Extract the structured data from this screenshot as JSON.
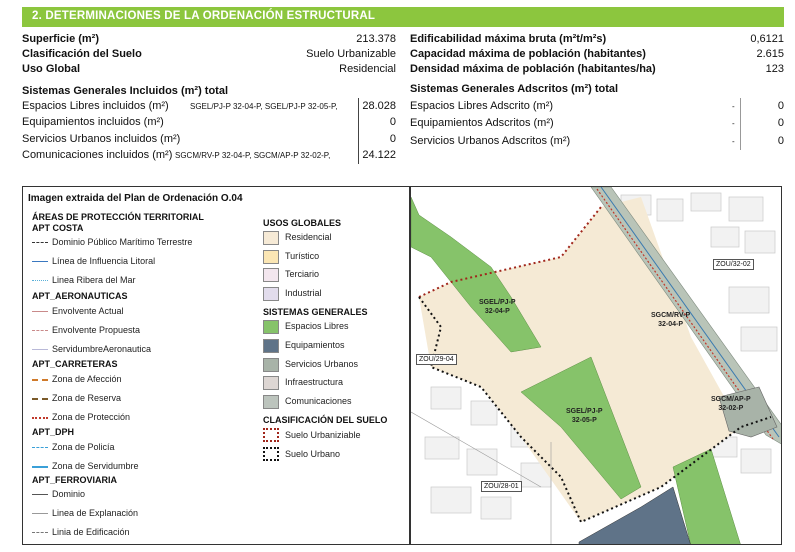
{
  "header": {
    "title": "2. DETERMINACIONES DE LA ORDENACIÓN ESTRUCTURAL"
  },
  "summary_left": [
    {
      "label": "Superficie (m²)",
      "value": "213.378"
    },
    {
      "label": "Clasificación del Suelo",
      "value": "Suelo Urbanizable"
    },
    {
      "label": "Uso Global",
      "value": "Residencial"
    }
  ],
  "summary_right": [
    {
      "label": "Edificabilidad máxima bruta  (m²t/m²s)",
      "value": "0,6121"
    },
    {
      "label": "Capacidad máxima de población (habitantes)",
      "value": "2.615"
    },
    {
      "label": "Densidad máxima de población (habitantes/ha)",
      "value": "123"
    }
  ],
  "sg_incluidos": {
    "title": "Sistemas Generales Incluidos (m²) total",
    "rows": [
      {
        "label": "Espacios Libres incluidos (m²)",
        "codes": "SGEL/PJ-P 32-04-P, SGEL/PJ-P 32-05-P,",
        "value": "28.028"
      },
      {
        "label": "Equipamientos incluidos (m²)",
        "codes": "",
        "value": "0"
      },
      {
        "label": "Servicios Urbanos incluidos  (m²)",
        "codes": "",
        "value": "0"
      },
      {
        "label": "Comunicaciones  incluidos (m²)",
        "codes": "SGCM/RV-P 32-04-P,  SGCM/AP-P 32-02-P,",
        "value": "24.122"
      }
    ]
  },
  "sg_adscritos": {
    "title": "Sistemas Generales Adscritos (m²) total",
    "rows": [
      {
        "label": "Espacios Libres Adscrito  (m²)",
        "dash": "-",
        "value": "0"
      },
      {
        "label": "Equipamientos Adscritos  (m²)",
        "dash": "-",
        "value": "0"
      },
      {
        "label": "Servicios Urbanos Adscritos  (m²)",
        "dash": "-",
        "value": "0"
      }
    ]
  },
  "legend": {
    "title": "Imagen extraida del Plan de Ordenación O.04",
    "apt_heading": "ÁREAS DE PROTECCIÓN TERRITORIAL",
    "apt_costa": "APT COSTA",
    "costa_items": [
      "Dominio Público Marítimo Terrestre",
      "Línea de Influencia Litoral",
      "Linea Ribera del Mar"
    ],
    "aero_heading": "APT_AERONAUTICAS",
    "aero_items": [
      "Envolvente Actual",
      "Envolvente Propuesta",
      "ServidumbreAeronautica"
    ],
    "carreteras_heading": "APT_CARRETERAS",
    "carreteras_items": [
      "Zona de Afección",
      "Zona de Reserva",
      "Zona de Protección"
    ],
    "dph_heading": "APT_DPH",
    "dph_items": [
      "Zona de Policía",
      "Zona de Servidumbre"
    ],
    "ferro_heading": "APT_FERROVIARIA",
    "ferro_items": [
      "Dominio",
      "Linea de Explanación",
      "Linia de Edificación"
    ],
    "usos_heading": "USOS GLOBALES",
    "usos_items": [
      {
        "label": "Residencial",
        "color": "#f6ead6"
      },
      {
        "label": "Turístico",
        "color": "#fbe6b4"
      },
      {
        "label": "Terciario",
        "color": "#f3e6ee"
      },
      {
        "label": "Industrial",
        "color": "#e2dcec"
      }
    ],
    "sg_heading": "SISTEMAS GENERALES",
    "sg_items": [
      {
        "label": "Espacios Libres",
        "color": "#86c36a"
      },
      {
        "label": "Equipamientos",
        "color": "#5f7388"
      },
      {
        "label": "Servicios Urbanos",
        "color": "#a8b3a8"
      },
      {
        "label": "Infraestructura",
        "color": "#ddd6d3"
      },
      {
        "label": "Comunicaciones",
        "color": "#bcc4bd"
      }
    ],
    "clasif_heading": "CLASIFICACIÓN DEL SUELO",
    "clasif_items": [
      "Suelo Urbaniziable",
      "Suelo Urbano"
    ]
  },
  "map": {
    "labels": {
      "zou_32_02": "ZOU/32-02",
      "zou_29_04": "ZOU/29-04",
      "zou_28_01": "ZOU/28-01",
      "sgel_04_a": "SGEL/PJ-P",
      "sgel_04_b": "32-04-P",
      "sgel_05_a": "SGEL/PJ-P",
      "sgel_05_b": "32-05-P",
      "sgcm_rv_a": "SGCM/RV-P",
      "sgcm_rv_b": "32-04-P",
      "sgcm_ap_a": "SGCM/AP-P",
      "sgcm_ap_b": "32-02-P"
    }
  }
}
